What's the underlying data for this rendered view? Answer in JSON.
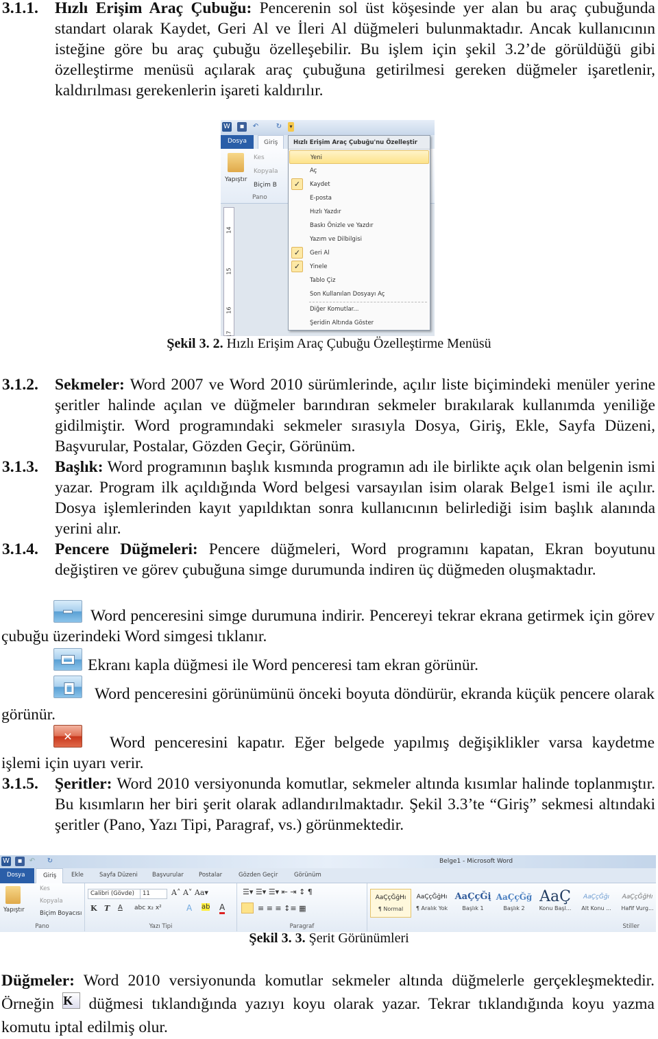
{
  "sections": [
    {
      "num": "3.1.1.",
      "title": "Hızlı Erişim Araç Çubuğu:",
      "text": " Pencerenin sol üst köşesinde yer alan bu araç çubuğunda standart olarak Kaydet, Geri Al ve İleri Al düğmeleri bulunmaktadır. Ancak kullanıcının isteğine göre bu araç çubuğu özelleşebilir. Bu işlem için şekil 3.2’de görüldüğü gibi özelleştirme menüsü açılarak araç çubuğuna getirilmesi gereken düğmeler işaretlenir, kaldırılması gerekenlerin işareti kaldırılır."
    },
    {
      "num": "3.1.2.",
      "title": "Sekmeler:",
      "text": " Word 2007 ve Word 2010 sürümlerinde,  açılır liste biçimindeki menüler yerine şeritler halinde açılan ve düğmeler barındıran sekmeler bırakılarak kullanımda yeniliğe gidilmiştir. Word programındaki sekmeler sırasıyla Dosya, Giriş, Ekle, Sayfa Düzeni, Başvurular, Postalar, Gözden Geçir, Görünüm."
    },
    {
      "num": "3.1.3.",
      "title": "Başlık:",
      "text": " Word programının başlık kısmında programın adı ile birlikte açık olan belgenin ismi yazar. Program ilk açıldığında Word belgesi varsayılan isim olarak Belge1 ismi ile açılır. Dosya işlemlerinden kayıt yapıldıktan sonra kullanıcının belirlediği isim başlık alanında yerini alır."
    },
    {
      "num": "3.1.4.",
      "title": "Pencere Düğmeleri:",
      "text": " Pencere düğmeleri, Word programını kapatan, Ekran boyutunu değiştiren ve görev çubuğuna simge durumunda indiren üç düğmeden oluşmaktadır."
    },
    {
      "num": "3.1.5.",
      "title": "Şeritler:",
      "text": " Word 2010 versiyonunda komutlar, sekmeler altında kısımlar halinde toplanmıştır. Bu kısımların her biri şerit olarak adlandırılmaktadır. Şekil 3.3’te “Giriş” sekmesi altındaki şeritler (Pano, Yazı Tipi, Paragraf, vs.)  görünmektedir."
    }
  ],
  "window_buttons": [
    {
      "icon": "minimize-icon",
      "text": "Word penceresini simge durumuna indirir. Pencereyi tekrar ekrana getirmek için görev çubuğu üzerindeki Word simgesi tıklanır."
    },
    {
      "icon": "maximize-icon",
      "text": "Ekranı kapla düğmesi ile Word penceresi tam ekran görünür."
    },
    {
      "icon": "restore-icon",
      "text": "Word penceresini görünümünü önceki boyuta döndürür, ekranda küçük pencere olarak görünür."
    },
    {
      "icon": "close-icon",
      "text": "Word penceresini kapatır. Eğer belgede yapılmış değişiklikler varsa kaydetme işlemi için uyarı verir."
    }
  ],
  "figure_3_2": {
    "caption_num": "Şekil 3. 2.",
    "caption": " Hızlı Erişim Araç Çubuğu Özelleştirme Menüsü",
    "tabs": [
      "Dosya",
      "Giriş"
    ],
    "clipboard": {
      "paste": "Yapıştır",
      "cut": "Kes",
      "copy": "Kopyala",
      "format": "Biçim B",
      "group": "Pano"
    },
    "menu": {
      "title": "Hızlı Erişim Araç Çubuğu'nu Özelleştir",
      "items": [
        {
          "label": "Yeni",
          "checked": false,
          "highlighted": true
        },
        {
          "label": "Aç",
          "checked": false
        },
        {
          "label": "Kaydet",
          "checked": true
        },
        {
          "label": "E-posta",
          "checked": false
        },
        {
          "label": "Hızlı Yazdır",
          "checked": false
        },
        {
          "label": "Baskı Önizle ve Yazdır",
          "checked": false
        },
        {
          "label": "Yazım ve Dilbilgisi",
          "checked": false
        },
        {
          "label": "Geri Al",
          "checked": true
        },
        {
          "label": "Yinele",
          "checked": true
        },
        {
          "label": "Tablo Çiz",
          "checked": false
        },
        {
          "label": "Son Kullanılan Dosyayı Aç",
          "checked": false
        },
        {
          "label": "Diğer Komutlar...",
          "checked": false
        },
        {
          "label": "Şeridin Altında Göster",
          "checked": false
        }
      ]
    },
    "ruler": [
      "14",
      "15",
      "16",
      "17"
    ]
  },
  "figure_3_3": {
    "caption_num": "Şekil 3. 3.",
    "caption": " Şerit Görünümleri",
    "title": "Belge1  -  Microsoft Word",
    "tabs": [
      "Dosya",
      "Giriş",
      "Ekle",
      "Sayfa Düzeni",
      "Başvurular",
      "Postalar",
      "Gözden Geçir",
      "Görünüm"
    ],
    "groups": [
      "Pano",
      "Yazı Tipi",
      "Paragraf",
      "Stiller"
    ],
    "clipboard": {
      "paste": "Yapıştır",
      "cut": "Kes",
      "copy": "Kopyala",
      "format": "Biçim Boyacısı"
    },
    "font": {
      "name": "Calibri (Gövde)",
      "size": "11",
      "bold": "K",
      "italic": "T",
      "underline": "A"
    },
    "styles": [
      {
        "preview": "AaÇçĞğHı",
        "name": "¶ Normal"
      },
      {
        "preview": "AaÇçĞğHı",
        "name": "¶ Aralık Yok"
      },
      {
        "preview": "AaÇçĞį",
        "name": "Başlık 1"
      },
      {
        "preview": "AaÇçĞğ",
        "name": "Başlık 2"
      },
      {
        "preview": "AaÇ",
        "name": "Konu Başl..."
      },
      {
        "preview": "AaÇçĞğı",
        "name": "Alt Konu ..."
      },
      {
        "preview": "AaÇçĞğHı",
        "name": "Hafif Vurg..."
      }
    ]
  },
  "buttons_para": {
    "title": "Düğmeler:",
    "text1": " Word 2010 versiyonunda komutlar sekmeler altında düğmelerle gerçekleşmektedir. Örneğin",
    "bold_icon": "K",
    "text2": " düğmesi tıklandığında yazıyı koyu olarak yazar. Tekrar tıklandığında koyu yazma komutu iptal edilmiş olur."
  }
}
